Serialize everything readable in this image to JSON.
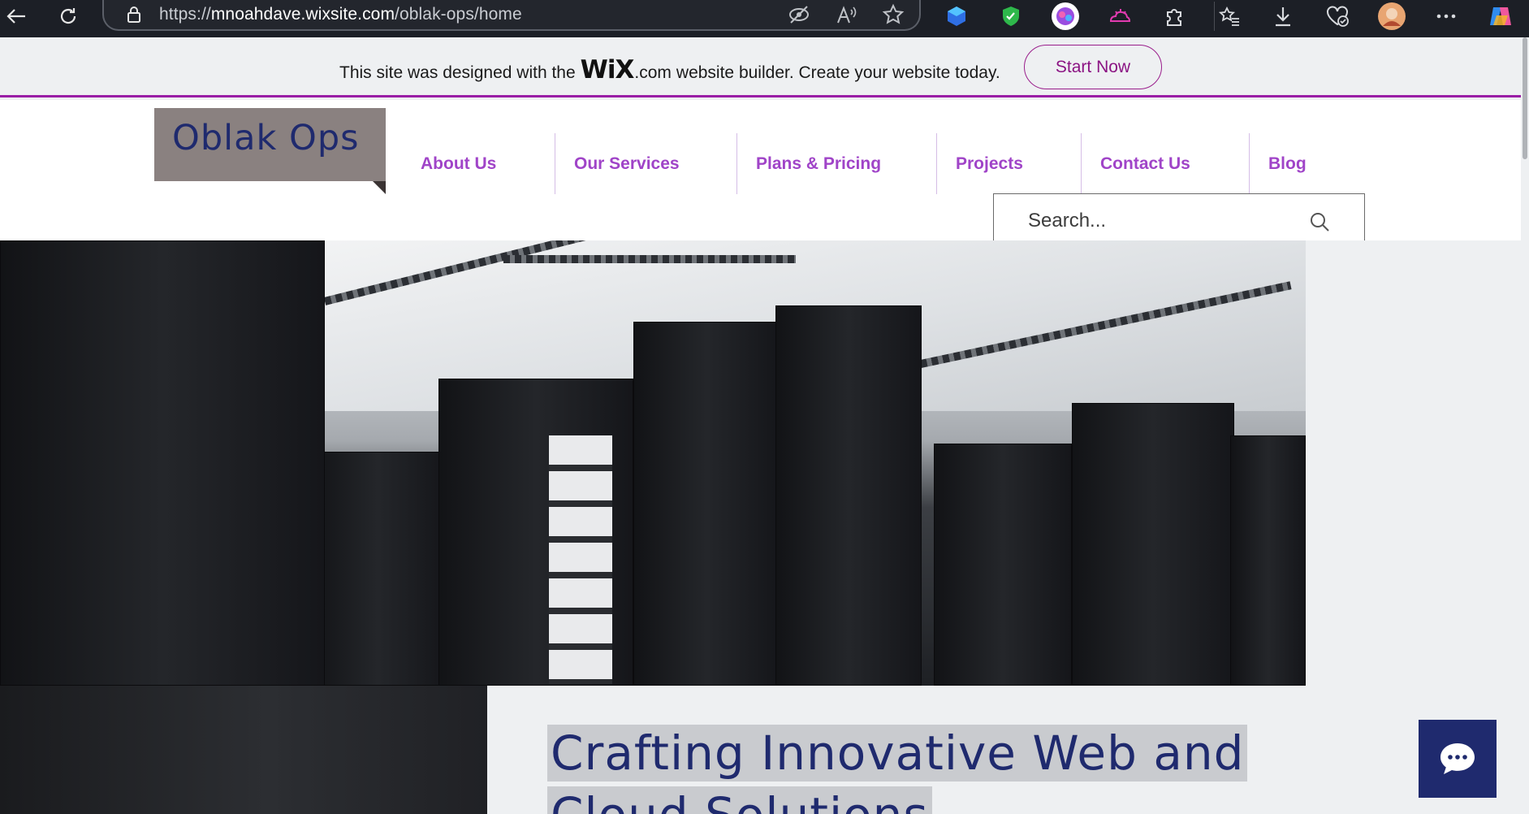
{
  "browser": {
    "url_scheme": "https://",
    "url_domain": "mnoahdave.wixsite.com",
    "url_path": "/oblak-ops/home"
  },
  "wix_banner": {
    "text_before": "This site was designed with the",
    "wix_logo": "WiX",
    "text_after_com": ".com",
    "text_after": "website builder. Create your website today.",
    "cta_label": "Start Now"
  },
  "site": {
    "logo_text": "Oblak Ops",
    "menu": [
      {
        "label": "About Us"
      },
      {
        "label": "Our Services"
      },
      {
        "label": "Plans & Pricing"
      },
      {
        "label": "Projects"
      },
      {
        "label": "Contact Us"
      },
      {
        "label": "Blog"
      }
    ],
    "search_placeholder": "Search..."
  },
  "hero": {
    "headline_line1": "Crafting Innovative Web and",
    "headline_line2": "Cloud Solutions"
  },
  "colors": {
    "brand_navy": "#1f2a6e",
    "menu_purple": "#a044c8",
    "wix_accent": "#9a1ea6"
  }
}
